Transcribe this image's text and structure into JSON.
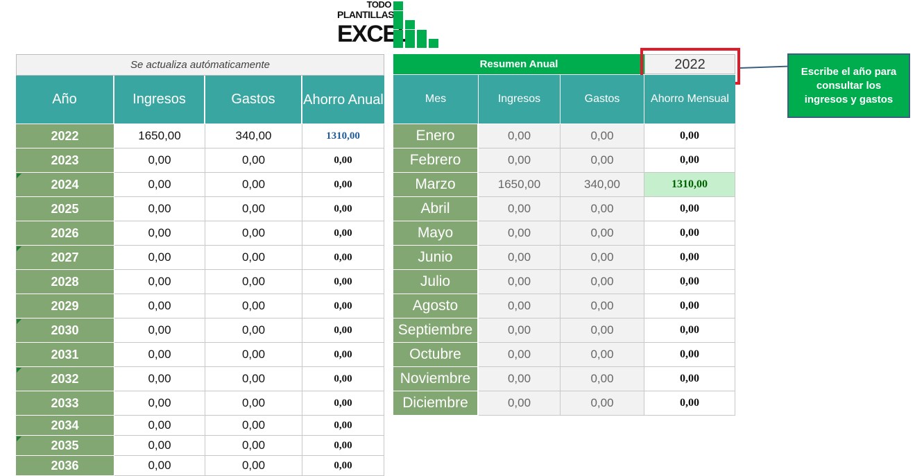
{
  "logo": {
    "line1": "TODO",
    "line2": "PLANTILLAS",
    "line3": "EXCEL",
    "color": "#00ad4e"
  },
  "left_table": {
    "subtitle": "Se actualiza autómaticamente",
    "headers": [
      "Año",
      "Ingresos",
      "Gastos",
      "Ahorro Anual"
    ],
    "rows": [
      {
        "year": "2022",
        "ingresos": "1650,00",
        "gastos": "340,00",
        "ahorro": "1310,00"
      },
      {
        "year": "2023",
        "ingresos": "0,00",
        "gastos": "0,00",
        "ahorro": "0,00"
      },
      {
        "year": "2024",
        "ingresos": "0,00",
        "gastos": "0,00",
        "ahorro": "0,00"
      },
      {
        "year": "2025",
        "ingresos": "0,00",
        "gastos": "0,00",
        "ahorro": "0,00"
      },
      {
        "year": "2026",
        "ingresos": "0,00",
        "gastos": "0,00",
        "ahorro": "0,00"
      },
      {
        "year": "2027",
        "ingresos": "0,00",
        "gastos": "0,00",
        "ahorro": "0,00"
      },
      {
        "year": "2028",
        "ingresos": "0,00",
        "gastos": "0,00",
        "ahorro": "0,00"
      },
      {
        "year": "2029",
        "ingresos": "0,00",
        "gastos": "0,00",
        "ahorro": "0,00"
      },
      {
        "year": "2030",
        "ingresos": "0,00",
        "gastos": "0,00",
        "ahorro": "0,00"
      },
      {
        "year": "2031",
        "ingresos": "0,00",
        "gastos": "0,00",
        "ahorro": "0,00"
      },
      {
        "year": "2032",
        "ingresos": "0,00",
        "gastos": "0,00",
        "ahorro": "0,00"
      },
      {
        "year": "2033",
        "ingresos": "0,00",
        "gastos": "0,00",
        "ahorro": "0,00"
      },
      {
        "year": "2034",
        "ingresos": "0,00",
        "gastos": "0,00",
        "ahorro": "0,00"
      },
      {
        "year": "2035",
        "ingresos": "0,00",
        "gastos": "0,00",
        "ahorro": "0,00"
      },
      {
        "year": "2036",
        "ingresos": "0,00",
        "gastos": "0,00",
        "ahorro": "0,00"
      }
    ]
  },
  "right_table": {
    "title": "Resumen Anual",
    "year_input": "2022",
    "headers": [
      "Mes",
      "Ingresos",
      "Gastos",
      "Ahorro Mensual"
    ],
    "rows": [
      {
        "mes": "Enero",
        "ingresos": "0,00",
        "gastos": "0,00",
        "ahorro": "0,00"
      },
      {
        "mes": "Febrero",
        "ingresos": "0,00",
        "gastos": "0,00",
        "ahorro": "0,00"
      },
      {
        "mes": "Marzo",
        "ingresos": "1650,00",
        "gastos": "340,00",
        "ahorro": "1310,00"
      },
      {
        "mes": "Abril",
        "ingresos": "0,00",
        "gastos": "0,00",
        "ahorro": "0,00"
      },
      {
        "mes": "Mayo",
        "ingresos": "0,00",
        "gastos": "0,00",
        "ahorro": "0,00"
      },
      {
        "mes": "Junio",
        "ingresos": "0,00",
        "gastos": "0,00",
        "ahorro": "0,00"
      },
      {
        "mes": "Julio",
        "ingresos": "0,00",
        "gastos": "0,00",
        "ahorro": "0,00"
      },
      {
        "mes": "Agosto",
        "ingresos": "0,00",
        "gastos": "0,00",
        "ahorro": "0,00"
      },
      {
        "mes": "Septiembre",
        "ingresos": "0,00",
        "gastos": "0,00",
        "ahorro": "0,00"
      },
      {
        "mes": "Octubre",
        "ingresos": "0,00",
        "gastos": "0,00",
        "ahorro": "0,00"
      },
      {
        "mes": "Noviembre",
        "ingresos": "0,00",
        "gastos": "0,00",
        "ahorro": "0,00"
      },
      {
        "mes": "Diciembre",
        "ingresos": "0,00",
        "gastos": "0,00",
        "ahorro": "0,00"
      }
    ]
  },
  "callout": {
    "text": "Escribe el año para consultar los ingresos y gastos"
  },
  "colors": {
    "teal_header": "#3aa6a1",
    "year_col": "#83a772",
    "title_green": "#00ad4e",
    "highlight_red": "#e01b2a",
    "positive_bg": "#c6efce"
  }
}
